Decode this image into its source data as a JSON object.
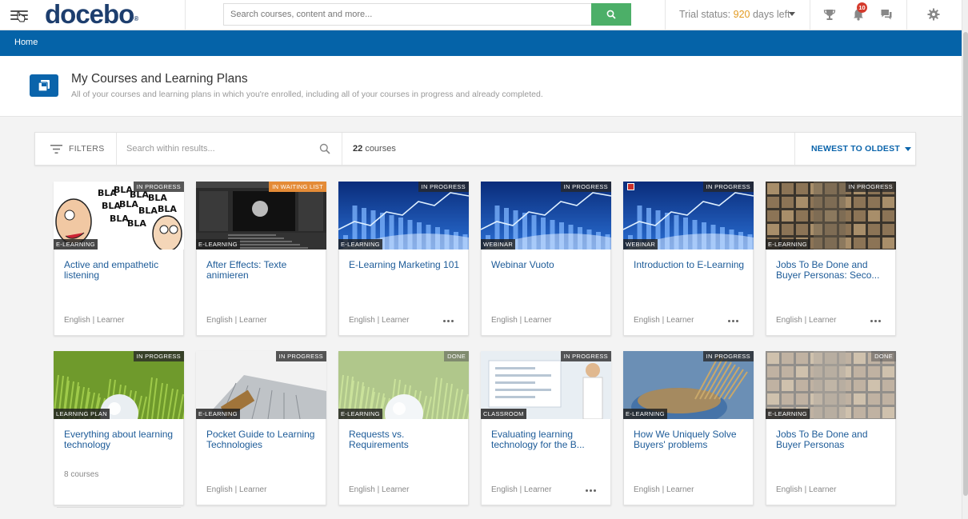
{
  "header": {
    "logo": "docebo",
    "search_placeholder": "Search courses, content and more...",
    "trial_label": "Trial status:",
    "trial_days": "920",
    "trial_suffix": "days left",
    "notification_count": "10"
  },
  "breadcrumb": {
    "home": "Home"
  },
  "page": {
    "title": "My Courses and Learning Plans",
    "subtitle": "All of your courses and learning plans in which you're enrolled, including all of your courses in progress and already completed."
  },
  "filterbar": {
    "filters_label": "FILTERS",
    "search_placeholder": "Search within results...",
    "count_number": "22",
    "count_label": "courses",
    "sort_label": "NEWEST TO OLDEST"
  },
  "colors": {
    "brand_blue": "#0563a8",
    "search_green": "#4caf68",
    "trial_orange": "#e29a1f",
    "title_blue": "#1d5b98"
  },
  "cards": [
    {
      "title": "Active and empathetic listening",
      "status": "IN PROGRESS",
      "type": "E-LEARNING",
      "meta": "English | Learner",
      "thumb": "bla"
    },
    {
      "title": "After Effects: Texte animieren",
      "status": "IN WAITING LIST",
      "type": "E-LEARNING",
      "meta": "English | Learner",
      "thumb": "ae"
    },
    {
      "title": "E-Learning Marketing 101",
      "status": "IN PROGRESS",
      "type": "E-LEARNING",
      "meta": "English | Learner",
      "thumb": "graph"
    },
    {
      "title": "Webinar Vuoto",
      "status": "IN PROGRESS",
      "type": "WEBINAR",
      "meta": "English | Learner",
      "thumb": "graph"
    },
    {
      "title": "Introduction to E-Learning",
      "status": "IN PROGRESS",
      "type": "WEBINAR",
      "meta": "English | Learner",
      "thumb": "graph"
    },
    {
      "title": "Jobs To Be Done and Buyer Personas: Seco...",
      "status": "IN PROGRESS",
      "type": "E-LEARNING",
      "meta": "English | Learner",
      "thumb": "warehouse"
    },
    {
      "title": "Everything about learning technology",
      "status": "IN PROGRESS",
      "type": "LEARNING PLAN",
      "meta": "8 courses",
      "thumb": "bulb"
    },
    {
      "title": "Pocket Guide to Learning Technologies",
      "status": "IN PROGRESS",
      "type": "E-LEARNING",
      "meta": "English | Learner",
      "thumb": "laptop"
    },
    {
      "title": "Requests vs. Requirements",
      "status": "DONE",
      "type": "E-LEARNING",
      "meta": "English | Learner",
      "thumb": "bulb-faded"
    },
    {
      "title": "Evaluating learning technology for the B...",
      "status": "IN PROGRESS",
      "type": "CLASSROOM",
      "meta": "English | Learner",
      "thumb": "classroom"
    },
    {
      "title": "How We Uniquely Solve Buyers' problems",
      "status": "IN PROGRESS",
      "type": "E-LEARNING",
      "meta": "English | Learner",
      "thumb": "grain"
    },
    {
      "title": "Jobs To Be Done and Buyer Personas",
      "status": "DONE",
      "type": "E-LEARNING",
      "meta": "English | Learner",
      "thumb": "warehouse-faded"
    }
  ]
}
